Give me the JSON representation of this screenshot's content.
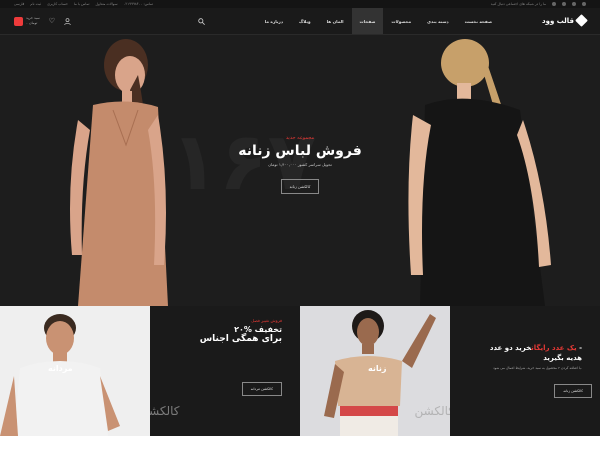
{
  "topbar": {
    "left_links": [
      "فارسی",
      "ثبت نام",
      "حساب کاربری",
      "تماس با ما",
      "سوالات متداول",
      "تماس: ۰۲۱۹۹۹۸۴۰۰"
    ],
    "right_text": "ما را در شبکه های اجتماعی دنبال کنید"
  },
  "header": {
    "cart_label": "سبد خرید",
    "cart_total": "۰ تومان",
    "nav": [
      {
        "label": "صفحه نخست",
        "active": false
      },
      {
        "label": "دسته بندی",
        "active": false
      },
      {
        "label": "محصولات",
        "active": false
      },
      {
        "label": "صفحات",
        "active": true
      },
      {
        "label": "المان ها",
        "active": false
      },
      {
        "label": "وبلاگ",
        "active": false
      },
      {
        "label": "درباره ما",
        "active": false
      }
    ],
    "logo": "قالب وود"
  },
  "hero": {
    "tag": "مجموعه جدید",
    "title": "فروش لباس زنانه",
    "subtitle": "تحویل سراسر کشور ۱,۴۰۰,۰۰۰ تومان",
    "button": "کالکشن زنانه",
    "bg_number": "۱۶۷"
  },
  "banners": {
    "men_caption": "مردانه",
    "promo1": {
      "t1": "فروش تغییر فصل",
      "t2": "۲۰% تخفیف",
      "t3": "برای همگی اجناس",
      "button": "کالکشن مردانه"
    },
    "women_caption": "زنانه",
    "promo2": {
      "t1a": "خرید دو عدد - ",
      "t1b": "یک عدد رایگان",
      "t2": "هدیه بگیرید",
      "t3": "با اضافه کردن ۲ محصول به سبد خرید، شرایط اعمال می شود.",
      "button": "کالکشن زنانه"
    },
    "watermark": "کالکشن"
  }
}
